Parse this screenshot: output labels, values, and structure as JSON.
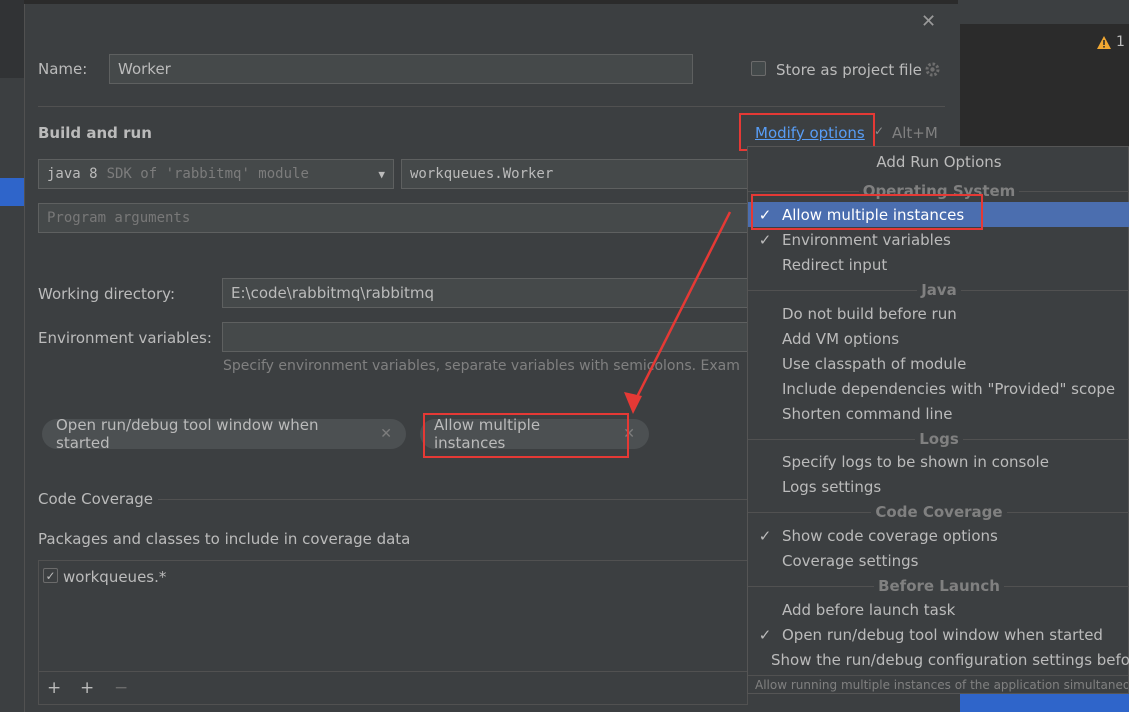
{
  "warning_count": "1",
  "dialog": {
    "name_label": "Name:",
    "name_value": "Worker",
    "store_label": "Store as project file",
    "build_run_title": "Build and run",
    "modify_options": "Modify options",
    "modify_shortcut": "Alt+M",
    "jdk_bold": "java 8",
    "jdk_rest": "SDK of 'rabbitmq' module",
    "main_class": "workqueues.Worker",
    "program_args_placeholder": "Program arguments",
    "working_dir_label": "Working directory:",
    "working_dir_value": "E:\\code\\rabbitmq\\rabbitmq",
    "env_label": "Environment variables:",
    "env_hint": "Specify environment variables, separate variables with semicolons. Exam",
    "chips": [
      "Open run/debug tool window when started",
      "Allow multiple instances"
    ],
    "coverage_title": "Code Coverage",
    "packages_label": "Packages and classes to include in coverage data",
    "coverage_item": "workqueues.*"
  },
  "popup": {
    "title": "Add Run Options",
    "groups": {
      "os": "Operating System",
      "java": "Java",
      "logs": "Logs",
      "coverage": "Code Coverage",
      "before": "Before Launch"
    },
    "items": {
      "allow_multiple": "Allow multiple instances",
      "env_vars": "Environment variables",
      "redirect_input": "Redirect input",
      "no_build": "Do not build before run",
      "vm_options": "Add VM options",
      "classpath": "Use classpath of module",
      "include_deps": "Include dependencies with \"Provided\" scope",
      "shorten": "Shorten command line",
      "logs_console": "Specify logs to be shown in console",
      "logs_settings": "Logs settings",
      "show_coverage": "Show code coverage options",
      "coverage_settings": "Coverage settings",
      "add_before": "Add before launch task",
      "open_tool": "Open run/debug tool window when started",
      "show_settings": "Show the run/debug configuration settings befo"
    },
    "checked_mark": "✓",
    "footer": "Allow running multiple instances of the application simultaneousl"
  },
  "colors": {
    "accent": "#4b6eaf",
    "highlight": "#e53935",
    "link": "#589df6"
  }
}
